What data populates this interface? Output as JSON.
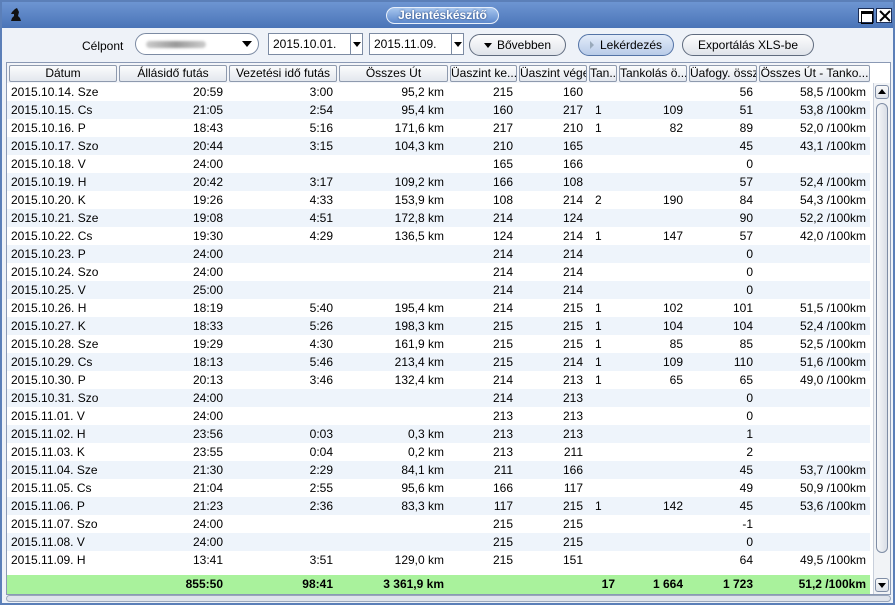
{
  "window": {
    "title": "Jelentéskészítő",
    "accent": "#4a74b7"
  },
  "toolbar": {
    "celpont_label": "Célpont",
    "date_from": "2015.10.01.",
    "date_to": "2015.11.09.",
    "more_label": "Bővebben",
    "query_label": "Lekérdezés",
    "export_label": "Exportálás XLS-be"
  },
  "table": {
    "columns": [
      "Dátum",
      "Állásidő futás",
      "Vezetési idő futás",
      "Összes Út",
      "Üaszint ke...",
      "Üaszint vége",
      "Tan...",
      "Tankolás ö...",
      "Üafogy. össz",
      "Összes Út - Tanko..."
    ],
    "rows": [
      [
        "2015.10.14. Sze",
        "20:59",
        "3:00",
        "95,2 km",
        "215",
        "160",
        "",
        "",
        "56",
        "58,5 /100km"
      ],
      [
        "2015.10.15. Cs",
        "21:05",
        "2:54",
        "95,4 km",
        "160",
        "217",
        "1",
        "109",
        "51",
        "53,8 /100km"
      ],
      [
        "2015.10.16. P",
        "18:43",
        "5:16",
        "171,6 km",
        "217",
        "210",
        "1",
        "82",
        "89",
        "52,0 /100km"
      ],
      [
        "2015.10.17. Szo",
        "20:44",
        "3:15",
        "104,3 km",
        "210",
        "165",
        "",
        "",
        "45",
        "43,1 /100km"
      ],
      [
        "2015.10.18. V",
        "24:00",
        "",
        "",
        "165",
        "166",
        "",
        "",
        "0",
        ""
      ],
      [
        "2015.10.19. H",
        "20:42",
        "3:17",
        "109,2 km",
        "166",
        "108",
        "",
        "",
        "57",
        "52,4 /100km"
      ],
      [
        "2015.10.20. K",
        "19:26",
        "4:33",
        "153,9 km",
        "108",
        "214",
        "2",
        "190",
        "84",
        "54,3 /100km"
      ],
      [
        "2015.10.21. Sze",
        "19:08",
        "4:51",
        "172,8 km",
        "214",
        "124",
        "",
        "",
        "90",
        "52,2 /100km"
      ],
      [
        "2015.10.22. Cs",
        "19:30",
        "4:29",
        "136,5 km",
        "124",
        "214",
        "1",
        "147",
        "57",
        "42,0 /100km"
      ],
      [
        "2015.10.23. P",
        "24:00",
        "",
        "",
        "214",
        "214",
        "",
        "",
        "0",
        ""
      ],
      [
        "2015.10.24. Szo",
        "24:00",
        "",
        "",
        "214",
        "214",
        "",
        "",
        "0",
        ""
      ],
      [
        "2015.10.25. V",
        "25:00",
        "",
        "",
        "214",
        "214",
        "",
        "",
        "0",
        ""
      ],
      [
        "2015.10.26. H",
        "18:19",
        "5:40",
        "195,4 km",
        "214",
        "215",
        "1",
        "102",
        "101",
        "51,5 /100km"
      ],
      [
        "2015.10.27. K",
        "18:33",
        "5:26",
        "198,3 km",
        "215",
        "215",
        "1",
        "104",
        "104",
        "52,4 /100km"
      ],
      [
        "2015.10.28. Sze",
        "19:29",
        "4:30",
        "161,9 km",
        "215",
        "215",
        "1",
        "85",
        "85",
        "52,5 /100km"
      ],
      [
        "2015.10.29. Cs",
        "18:13",
        "5:46",
        "213,4 km",
        "215",
        "214",
        "1",
        "109",
        "110",
        "51,6 /100km"
      ],
      [
        "2015.10.30. P",
        "20:13",
        "3:46",
        "132,4 km",
        "214",
        "213",
        "1",
        "65",
        "65",
        "49,0 /100km"
      ],
      [
        "2015.10.31. Szo",
        "24:00",
        "",
        "",
        "214",
        "213",
        "",
        "",
        "0",
        ""
      ],
      [
        "2015.11.01. V",
        "24:00",
        "",
        "",
        "213",
        "213",
        "",
        "",
        "0",
        ""
      ],
      [
        "2015.11.02. H",
        "23:56",
        "0:03",
        "0,3 km",
        "213",
        "213",
        "",
        "",
        "1",
        ""
      ],
      [
        "2015.11.03. K",
        "23:55",
        "0:04",
        "0,2 km",
        "213",
        "211",
        "",
        "",
        "2",
        ""
      ],
      [
        "2015.11.04. Sze",
        "21:30",
        "2:29",
        "84,1 km",
        "211",
        "166",
        "",
        "",
        "45",
        "53,7 /100km"
      ],
      [
        "2015.11.05. Cs",
        "21:04",
        "2:55",
        "95,6 km",
        "166",
        "117",
        "",
        "",
        "49",
        "50,9 /100km"
      ],
      [
        "2015.11.06. P",
        "21:23",
        "2:36",
        "83,3 km",
        "117",
        "215",
        "1",
        "142",
        "45",
        "53,6 /100km"
      ],
      [
        "2015.11.07. Szo",
        "24:00",
        "",
        "",
        "215",
        "215",
        "",
        "",
        "-1",
        ""
      ],
      [
        "2015.11.08. V",
        "24:00",
        "",
        "",
        "215",
        "215",
        "",
        "",
        "0",
        ""
      ],
      [
        "2015.11.09. H",
        "13:41",
        "3:51",
        "129,0 km",
        "215",
        "151",
        "",
        "",
        "64",
        "49,5 /100km"
      ]
    ],
    "totals": [
      "",
      "855:50",
      "98:41",
      "3 361,9 km",
      "",
      "",
      "17",
      "1 664",
      "1 723",
      "51,2 /100km"
    ],
    "footer_color": "#a9f29c"
  }
}
